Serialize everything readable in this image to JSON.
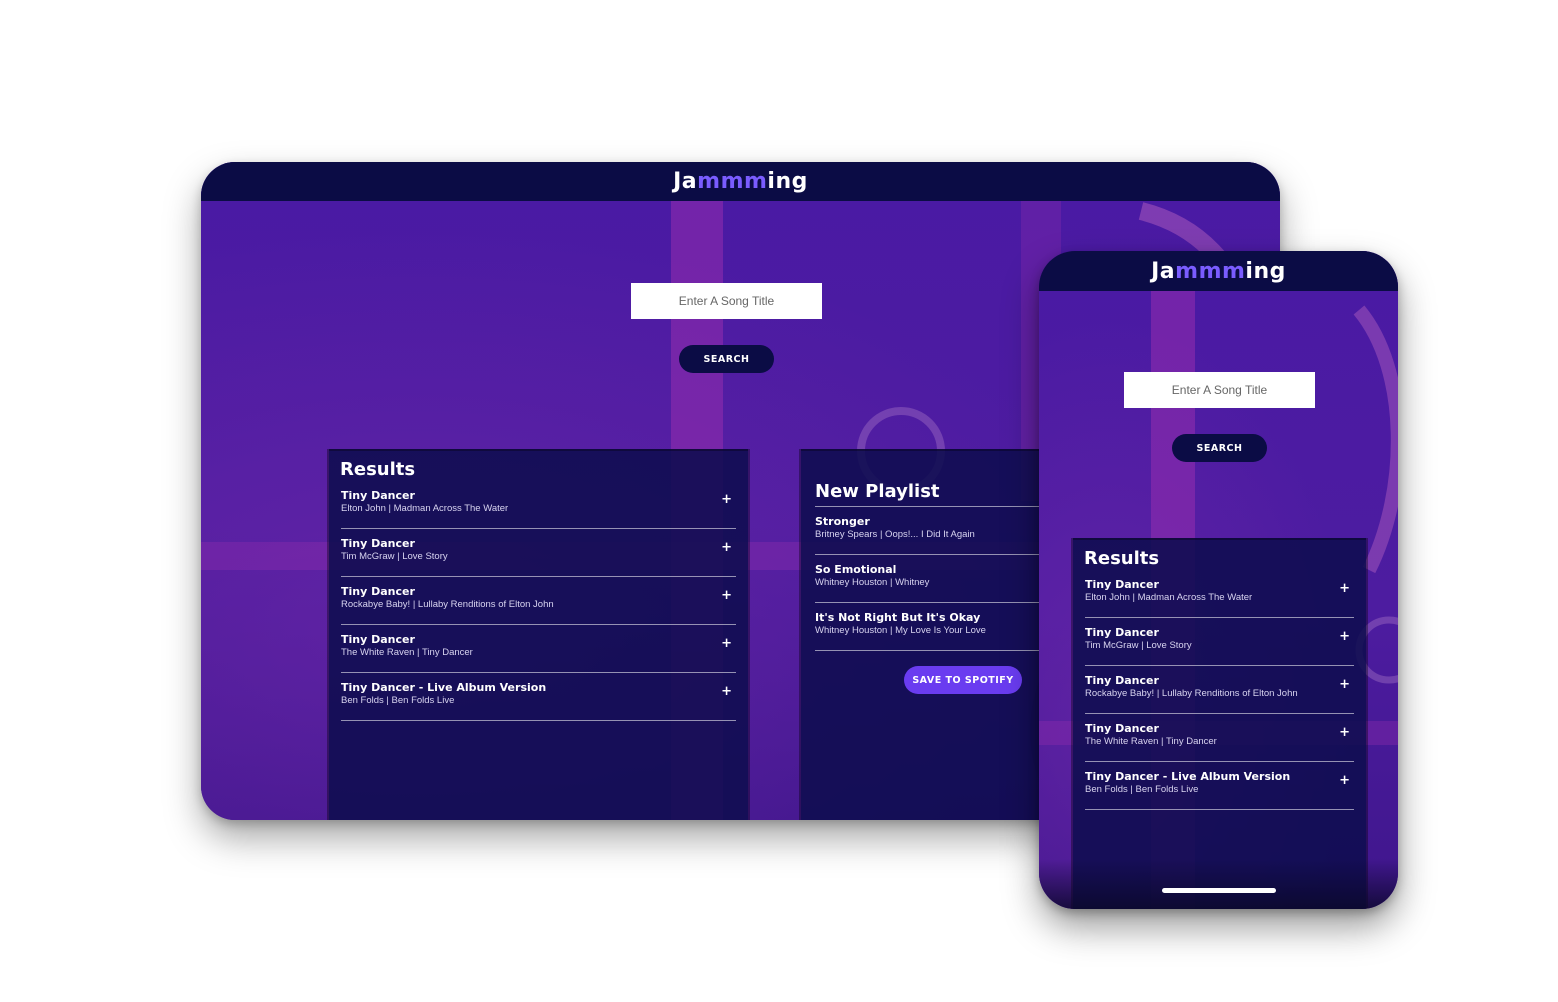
{
  "app": {
    "logo_prefix": "Ja",
    "logo_accent": "mmm",
    "logo_suffix": "ing"
  },
  "search": {
    "placeholder": "Enter A Song Title",
    "button_label": "SEARCH"
  },
  "results": {
    "title": "Results",
    "tracks": [
      {
        "name": "Tiny Dancer",
        "info": "Elton John | Madman Across The Water",
        "action": "+"
      },
      {
        "name": "Tiny Dancer",
        "info": "Tim McGraw | Love Story",
        "action": "+"
      },
      {
        "name": "Tiny Dancer",
        "info": "Rockabye Baby! | Lullaby Renditions of Elton John",
        "action": "+"
      },
      {
        "name": "Tiny Dancer",
        "info": "The White Raven | Tiny Dancer",
        "action": "+"
      },
      {
        "name": "Tiny Dancer - Live Album Version",
        "info": "Ben Folds | Ben Folds Live",
        "action": "+"
      }
    ]
  },
  "playlist": {
    "title": "New Playlist",
    "tracks": [
      {
        "name": "Stronger",
        "info": "Britney Spears | Oops!... I Did It Again"
      },
      {
        "name": "So Emotional",
        "info": "Whitney Houston | Whitney"
      },
      {
        "name": "It's Not Right But It's Okay",
        "info": "Whitney Houston | My Love Is Your Love"
      }
    ],
    "save_label": "SAVE TO SPOTIFY"
  },
  "colors": {
    "header": "#0b0c45",
    "accent": "#7a5cff",
    "save_button": "#6a3cf0",
    "background": "#4b1aa3"
  }
}
